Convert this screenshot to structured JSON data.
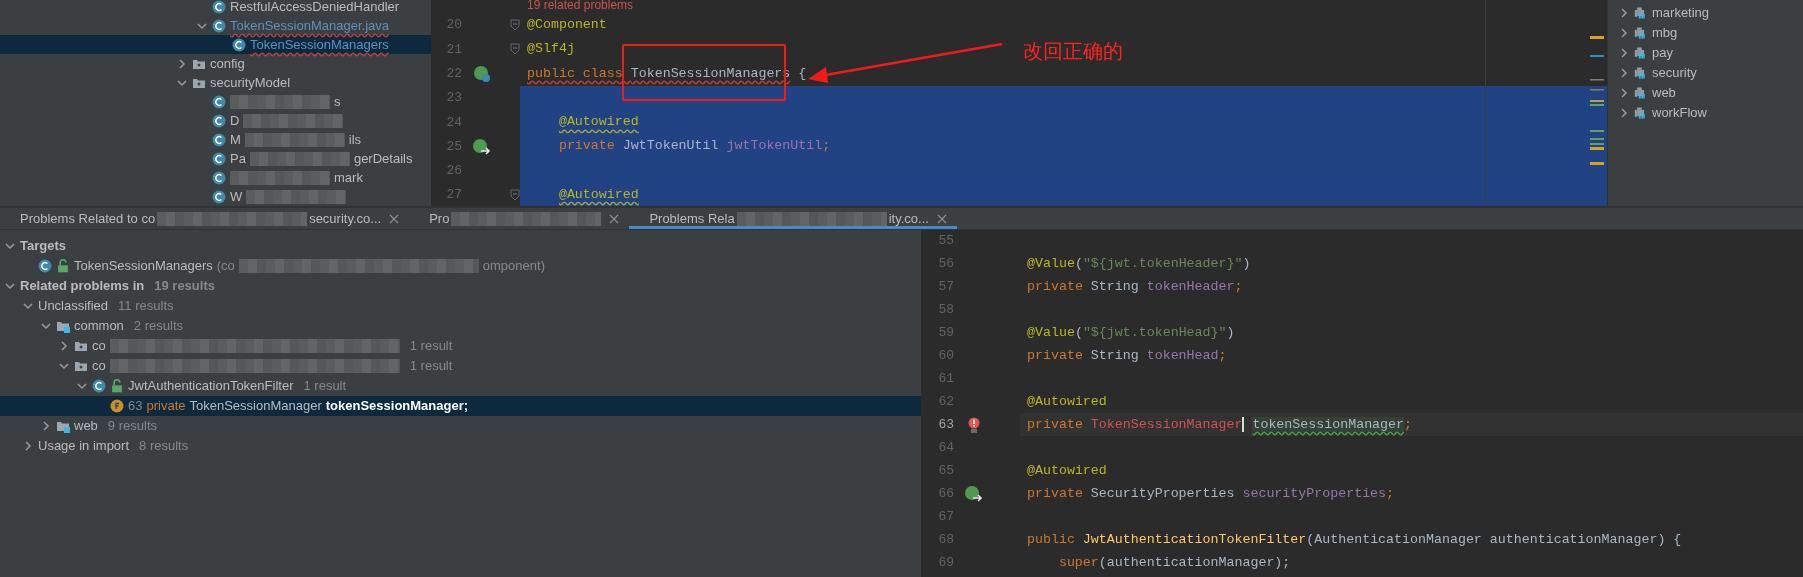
{
  "project_tree": {
    "clipped_children": [
      {
        "label": "RestfulAccessDeniedHandler",
        "kind": "class",
        "selected": false
      },
      {
        "label": "TokenSessionManager.java",
        "kind": "class",
        "expanded": true,
        "error": true,
        "selected": false,
        "children": [
          {
            "label": "TokenSessionManagers",
            "kind": "class",
            "error": true,
            "selected": true
          }
        ]
      }
    ],
    "items": [
      {
        "label": "config",
        "kind": "package",
        "expanded": false,
        "selected": false
      },
      {
        "label": "securityModel",
        "kind": "package",
        "expanded": true,
        "selected": false,
        "children": [
          {
            "label_end": "s",
            "kind": "class",
            "selected": false
          },
          {
            "label_start": "D",
            "kind": "class",
            "selected": false
          },
          {
            "label_start": "M",
            "label_end": "ils",
            "kind": "class",
            "selected": false
          },
          {
            "label_start": "Pa",
            "label_end": "gerDetails",
            "kind": "class",
            "selected": false
          },
          {
            "label_end": "mark",
            "kind": "class",
            "selected": false
          },
          {
            "label_start": "W",
            "kind": "class",
            "selected": false
          }
        ]
      }
    ]
  },
  "editor": {
    "hint": "19 related problems",
    "lines": [
      {
        "number": "20",
        "fold": true,
        "selected": false,
        "tokens": [
          {
            "text": "@Component",
            "kind": "annotation"
          }
        ]
      },
      {
        "number": "21",
        "fold": true,
        "selected": false,
        "tokens": [
          {
            "text": "@Slf4j",
            "kind": "annotation"
          }
        ]
      },
      {
        "number": "22",
        "gutter_marker": {
          "kind": "bean"
        },
        "selected": false,
        "tokens": [
          {
            "text": "public class ",
            "kind": "keyword",
            "error_underline": true
          },
          {
            "text": "TokenSessionManagers",
            "kind": "plain",
            "error_underline": true
          },
          {
            "text": " {",
            "kind": "plain"
          }
        ]
      },
      {
        "number": "23",
        "selected": true
      },
      {
        "number": "24",
        "selected": true,
        "indented": true,
        "tokens": [
          {
            "text": "@Autowired",
            "kind": "annotation",
            "warning_underline": true
          }
        ]
      },
      {
        "number": "25",
        "gutter_marker": {
          "kind": "bean-arrow"
        },
        "selected": true,
        "indented": true,
        "tokens": [
          {
            "text": "private ",
            "kind": "keyword"
          },
          {
            "text": "JwtTokenUtil ",
            "kind": "plain"
          },
          {
            "text": "jwtTokenUtil",
            "kind": "field"
          },
          {
            "text": ";",
            "kind": "keyword"
          }
        ]
      },
      {
        "number": "26",
        "selected": true
      },
      {
        "number": "27",
        "fold": true,
        "selected": true,
        "indented": true,
        "tokens": [
          {
            "text": "@Autowired",
            "kind": "annotation",
            "warning_underline": true
          }
        ]
      }
    ]
  },
  "annotation": {
    "text": "改回正确的"
  },
  "modules": [
    {
      "label": "marketing",
      "expanded": false
    },
    {
      "label": "mbg",
      "expanded": false
    },
    {
      "label": "pay",
      "expanded": false
    },
    {
      "label": "security",
      "expanded": false
    },
    {
      "label": "web",
      "expanded": false
    },
    {
      "label": "workFlow",
      "expanded": false
    }
  ],
  "tabs": [
    {
      "label_start": "Problems Related to co",
      "label_end": "security.co...",
      "selected": false
    },
    {
      "label_start": "Pro",
      "selected": false
    },
    {
      "label_start": "Problems Rela",
      "label_end": "ity.co...",
      "selected": true
    }
  ],
  "problems": [
    {
      "kind": "group",
      "label": "Targets",
      "expanded": true,
      "selected": false,
      "children": [
        {
          "kind": "class",
          "label": "TokenSessionManagers",
          "public": true,
          "detail_start": "(co",
          "detail_end": "omponent)",
          "selected": false
        }
      ]
    },
    {
      "kind": "group",
      "label": "Related problems in",
      "count": "19 results",
      "expanded": true,
      "selected": false,
      "children": [
        {
          "kind": "category",
          "label": "Unclassified",
          "count": "11 results",
          "expanded": true,
          "selected": false,
          "children": [
            {
              "kind": "module",
              "label": "common",
              "count": "2 results",
              "expanded": true,
              "selected": false,
              "children": [
                {
                  "kind": "package",
                  "label": "co",
                  "count": "1 result",
                  "expanded": false,
                  "selected": false
                },
                {
                  "kind": "package",
                  "label": "co",
                  "count": "1 result",
                  "expanded": true,
                  "selected": false,
                  "children": [
                    {
                      "kind": "class",
                      "label": "JwtAuthenticationTokenFilter",
                      "public": true,
                      "count": "1 result",
                      "expanded": true,
                      "selected": false,
                      "children": [
                        {
                          "kind": "usage",
                          "selected": true,
                          "tokens": [
                            {
                              "text": "63",
                              "kind": "muted"
                            },
                            {
                              "text": "private",
                              "kind": "keyword"
                            },
                            {
                              "text": "TokenSessionManager",
                              "kind": "plain"
                            },
                            {
                              "text": "tokenSessionManager;",
                              "kind": "bold"
                            }
                          ]
                        }
                      ]
                    }
                  ]
                }
              ]
            },
            {
              "kind": "module",
              "label": "web",
              "count": "9 results",
              "expanded": false,
              "selected": false
            }
          ]
        },
        {
          "kind": "category",
          "label": "Usage in import",
          "count": "8 results",
          "expanded": false,
          "selected": false
        }
      ]
    }
  ],
  "source": {
    "lines": [
      {
        "number": "55"
      },
      {
        "number": "56",
        "tokens": [
          {
            "text": "@Value",
            "kind": "annotation"
          },
          {
            "text": "(",
            "kind": "plain"
          },
          {
            "text": "\"${jwt.tokenHeader}\"",
            "kind": "string"
          },
          {
            "text": ")",
            "kind": "plain"
          }
        ]
      },
      {
        "number": "57",
        "tokens": [
          {
            "text": "private ",
            "kind": "keyword"
          },
          {
            "text": "String ",
            "kind": "plain"
          },
          {
            "text": "tokenHeader",
            "kind": "field"
          },
          {
            "text": ";",
            "kind": "keyword"
          }
        ]
      },
      {
        "number": "58"
      },
      {
        "number": "59",
        "tokens": [
          {
            "text": "@Value",
            "kind": "annotation"
          },
          {
            "text": "(",
            "kind": "plain"
          },
          {
            "text": "\"${jwt.tokenHead}\"",
            "kind": "string"
          },
          {
            "text": ")",
            "kind": "plain"
          }
        ]
      },
      {
        "number": "60",
        "tokens": [
          {
            "text": "private ",
            "kind": "keyword"
          },
          {
            "text": "String ",
            "kind": "plain"
          },
          {
            "text": "tokenHead",
            "kind": "field"
          },
          {
            "text": ";",
            "kind": "keyword"
          }
        ]
      },
      {
        "number": "61"
      },
      {
        "number": "62",
        "tokens": [
          {
            "text": "@Autowired",
            "kind": "annotation"
          }
        ]
      },
      {
        "number": "63",
        "current": true,
        "gutter_marker": {
          "kind": "error"
        },
        "tokens": [
          {
            "text": "private ",
            "kind": "keyword"
          },
          {
            "text": "TokenSessionManager",
            "kind": "unresolved",
            "caret": true
          },
          {
            "text": "tokenSessionManager",
            "kind": "field-plain",
            "unused_underline": true,
            "highlight": true
          },
          {
            "text": ";",
            "kind": "keyword"
          }
        ]
      },
      {
        "number": "64"
      },
      {
        "number": "65",
        "tokens": [
          {
            "text": "@Autowired",
            "kind": "annotation"
          }
        ]
      },
      {
        "number": "66",
        "gutter_marker": {
          "kind": "bean-arrow"
        },
        "tokens": [
          {
            "text": "private ",
            "kind": "keyword"
          },
          {
            "text": "SecurityProperties ",
            "kind": "plain"
          },
          {
            "text": "securityProperties",
            "kind": "field"
          },
          {
            "text": ";",
            "kind": "keyword"
          }
        ]
      },
      {
        "number": "67"
      },
      {
        "number": "68",
        "tokens": [
          {
            "text": "public ",
            "kind": "keyword"
          },
          {
            "text": "JwtAuthenticationTokenFilter",
            "kind": "method"
          },
          {
            "text": "(AuthenticationManager authenticationManager) {",
            "kind": "plain"
          }
        ]
      },
      {
        "number": "69",
        "indented": true,
        "tokens": [
          {
            "text": "super",
            "kind": "keyword"
          },
          {
            "text": "(authenticationManager);",
            "kind": "plain"
          }
        ]
      }
    ]
  }
}
